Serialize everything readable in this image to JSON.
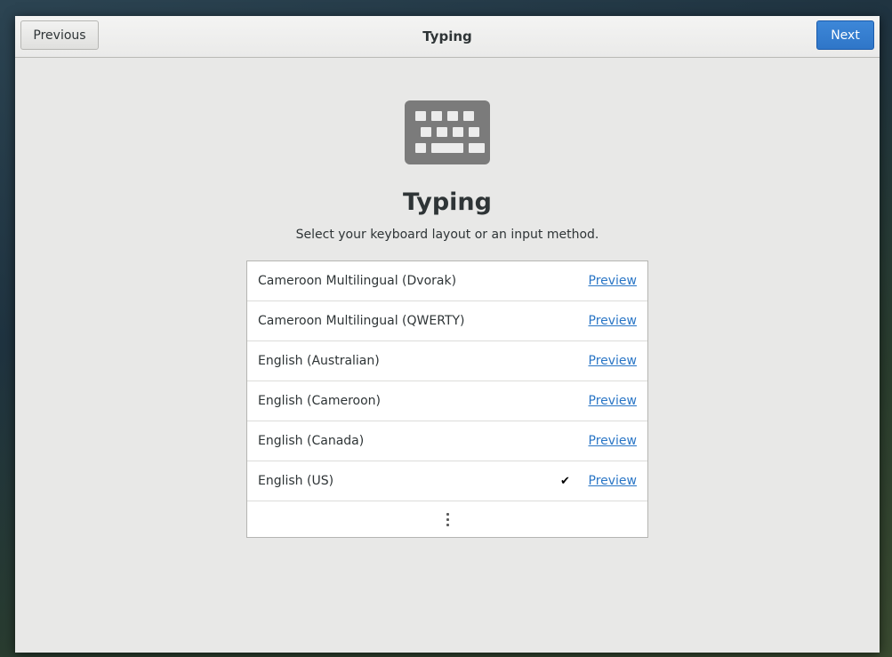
{
  "header": {
    "title": "Typing",
    "previous_label": "Previous",
    "next_label": "Next"
  },
  "main": {
    "icon": "keyboard-icon",
    "title": "Typing",
    "subtitle": "Select your keyboard layout or an input method.",
    "layouts": [
      {
        "label": "Cameroon Multilingual (Dvorak)",
        "preview": "Preview",
        "selected": false
      },
      {
        "label": "Cameroon Multilingual (QWERTY)",
        "preview": "Preview",
        "selected": false
      },
      {
        "label": "English (Australian)",
        "preview": "Preview",
        "selected": false
      },
      {
        "label": "English (Cameroon)",
        "preview": "Preview",
        "selected": false
      },
      {
        "label": "English (Canada)",
        "preview": "Preview",
        "selected": false
      },
      {
        "label": "English (US)",
        "preview": "Preview",
        "selected": true,
        "check": "✔"
      }
    ],
    "more_icon": "more-vertical-icon"
  },
  "colors": {
    "accent": "#2f76c8",
    "link": "#2a76c6",
    "icon": "#7b7b7b"
  }
}
